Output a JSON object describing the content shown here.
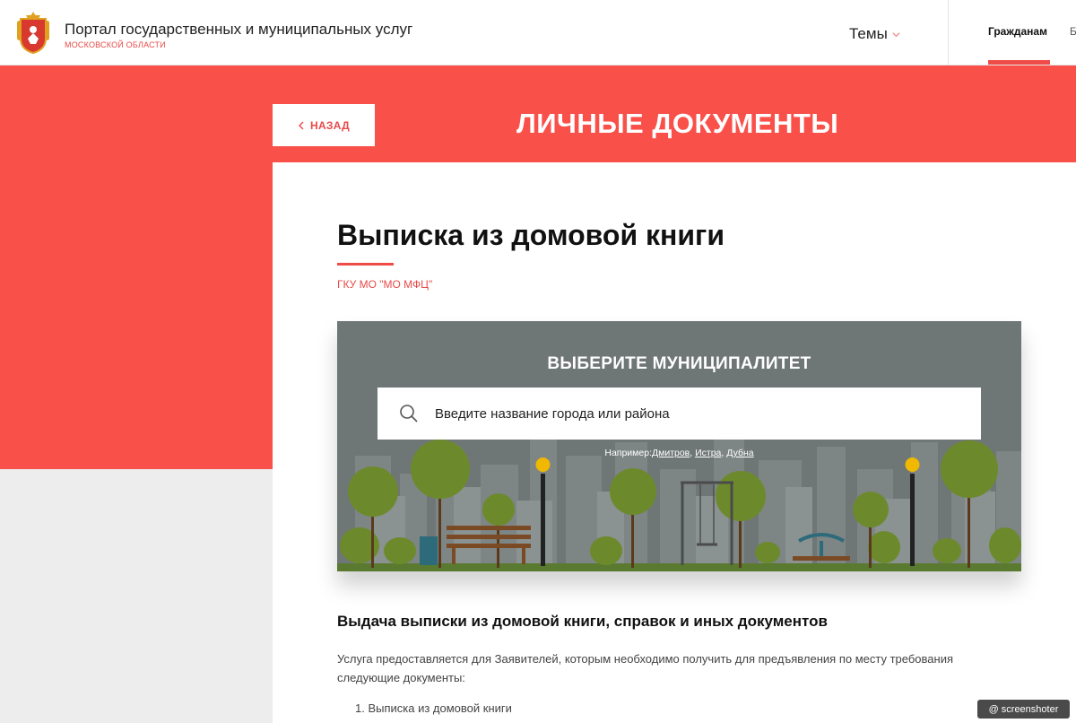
{
  "header": {
    "portal_title": "Портал государственных и муниципальных услуг",
    "portal_subtitle": "МОСКОВСКОЙ ОБЛАСТИ",
    "themes_label": "Темы",
    "nav": [
      {
        "label": "Гражданам",
        "active": true
      },
      {
        "label": "Б"
      }
    ]
  },
  "banner": {
    "back_label": "НАЗАД",
    "section_title": "ЛИЧНЫЕ ДОКУМЕНТЫ"
  },
  "service": {
    "title": "Выписка из домовой книги",
    "provider": "ГКУ МО \"МО МФЦ\""
  },
  "municipality": {
    "heading": "ВЫБЕРИТЕ МУНИЦИПАЛИТЕТ",
    "search_placeholder": "Введите название города или района",
    "examples_prefix": "Например:",
    "examples": [
      "Дмитров",
      "Истра",
      "Дубна"
    ]
  },
  "content": {
    "heading": "Выдача выписки из домовой книги, справок и иных документов",
    "description": "Услуга предоставляется для Заявителей, которым необходимо получить для предъявления по месту требования следующие документы:",
    "list": [
      "1. Выписка из домовой книги"
    ]
  },
  "watermark": "screenshoter",
  "colors": {
    "accent": "#f9504a",
    "accent_text": "#e84a48",
    "card_bg": "#6f7676"
  }
}
